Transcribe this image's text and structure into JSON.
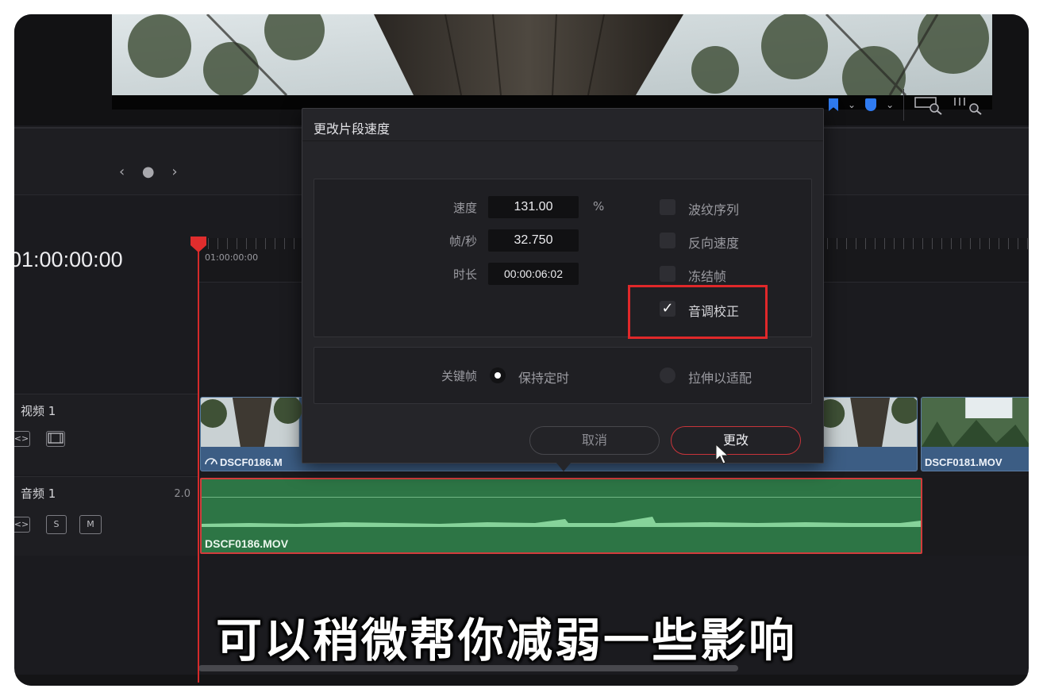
{
  "dialog": {
    "title": "更改片段速度",
    "speed_label": "速度",
    "speed_value": "131.00",
    "speed_unit": "%",
    "fps_label": "帧/秒",
    "fps_value": "32.750",
    "duration_label": "时长",
    "duration_value": "00:00:06:02",
    "options": [
      {
        "label": "波纹序列",
        "checked": false
      },
      {
        "label": "反向速度",
        "checked": false
      },
      {
        "label": "冻结帧",
        "checked": false
      },
      {
        "label": "音调校正",
        "checked": true
      }
    ],
    "keyframe_label": "关键帧",
    "keyframe_options": [
      {
        "label": "保持定时",
        "selected": true
      },
      {
        "label": "拉伸以适配",
        "selected": false
      }
    ],
    "cancel_label": "取消",
    "change_label": "更改"
  },
  "timeline": {
    "nav": "‹ ● ›",
    "timecode": "01:00:00:00",
    "ruler_label": "01:00:00:00",
    "video_track": {
      "name": "视频 1"
    },
    "audio_track": {
      "name": "音频 1",
      "level": "2.0",
      "solo": "S",
      "mute": "M"
    },
    "video_clips": [
      {
        "name": "DSCF0186.M"
      },
      {
        "name": "DSCF0181.MOV"
      }
    ],
    "audio_clip": {
      "name": "DSCF0186.MOV"
    }
  },
  "subtitle": "可以稍微帮你减弱一些影响",
  "colors": {
    "accent_blue": "#2f7bf1",
    "highlight_red": "#e0282a",
    "audio_green": "#2d7545",
    "video_blue": "#3c5d84"
  }
}
